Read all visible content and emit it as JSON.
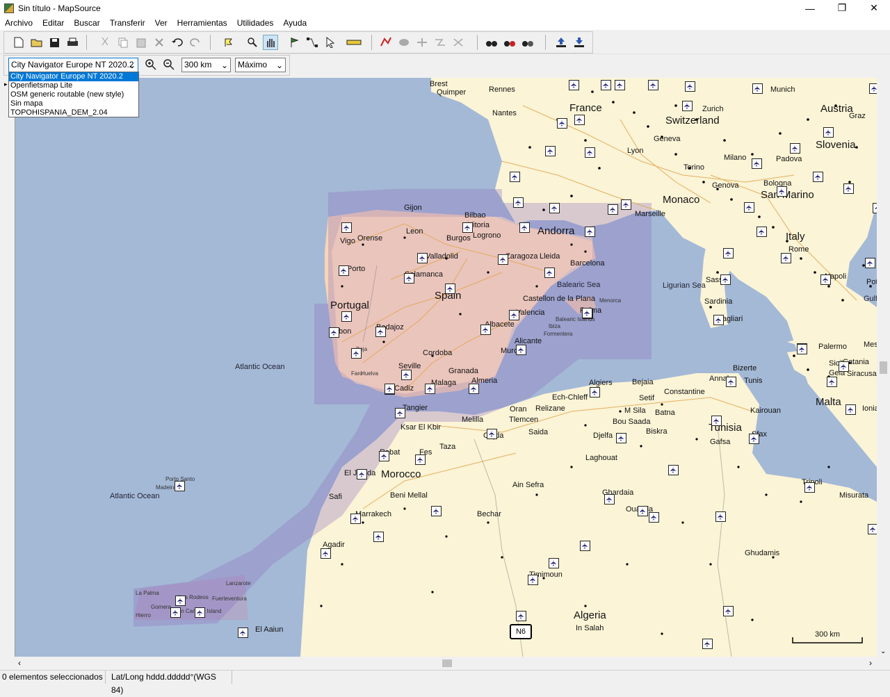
{
  "window": {
    "title": "Sin título - MapSource",
    "minimize": "—",
    "maximize": "❐",
    "close": "✕"
  },
  "menu": [
    "Archivo",
    "Editar",
    "Buscar",
    "Transferir",
    "Ver",
    "Herramientas",
    "Utilidades",
    "Ayuda"
  ],
  "toolbar2": {
    "map_product": "City Navigator Europe NT 2020.2",
    "map_options": [
      "City Navigator Europe NT 2020.2",
      "Openfietsmap Lite",
      "OSM generic routable (new style)",
      "Sin mapa",
      "TOPOHISPANIA_DEM_2.04"
    ],
    "zoom_scale": "300 km",
    "detail": "Máximo"
  },
  "map": {
    "countries": [
      {
        "t": "France"
      },
      {
        "t": "Switzerland"
      },
      {
        "t": "Austria"
      },
      {
        "t": "Slovenia"
      },
      {
        "t": "Monaco"
      },
      {
        "t": "San Marino"
      },
      {
        "t": "Italy"
      },
      {
        "t": "Andorra"
      },
      {
        "t": "Spain"
      },
      {
        "t": "Portugal"
      },
      {
        "t": "Morocco"
      },
      {
        "t": "Algeria"
      },
      {
        "t": "Tunisia"
      },
      {
        "t": "Malta"
      }
    ],
    "seas": [
      "Atlantic Ocean",
      "Atlantic Ocean",
      "Balearic Sea",
      "Ligurian Sea",
      "Gulf of"
    ],
    "cities": [
      "Brest",
      "Quimper",
      "Rennes",
      "Nantes",
      "Lyon",
      "Geneva",
      "Munich",
      "Zurich",
      "Graz",
      "Milano",
      "Torino",
      "Genova",
      "Bologna",
      "Padova",
      "Marseille",
      "Rome",
      "Napoli",
      "Potenz",
      "Sassari",
      "Sardinia",
      "Cagliari",
      "Palermo",
      "Messina",
      "Sicily",
      "Catania",
      "Gela",
      "Siracusa",
      "Ionian S",
      "Gijon",
      "Bilbao",
      "Vitoria",
      "Leon",
      "Burgos",
      "Logrono",
      "Vigo",
      "Orense",
      "Valladolid",
      "Zaragoza",
      "Lleida",
      "Barcelona",
      "Porto",
      "Salamanca",
      "Castellon de la Plana",
      "Palma",
      "Valencia",
      "Badajoz",
      "Lisbon",
      "Albacete",
      "Alicante",
      "Murcia",
      "Cordoba",
      "Seville",
      "Granada",
      "Malaga",
      "Almeria",
      "Cadiz",
      "Tangier",
      "Ksar El Kbir",
      "Melilla",
      "Oran",
      "Relizane",
      "Ech-Chleff",
      "Algiers",
      "Bejaia",
      "Setif",
      "Constantine",
      "Annaba",
      "Bizerte",
      "Tunis",
      "Kairouan",
      "Sfax",
      "Gafsa",
      "Batna",
      "Biskra",
      "M Sila",
      "Bou Saada",
      "Djelfa",
      "Tlemcen",
      "Oujda",
      "Saida",
      "Taza",
      "Fes",
      "Rabat",
      "El Jadida",
      "Safi",
      "Beni Mellal",
      "Marrakech",
      "Agadir",
      "Ain Sefra",
      "Bechar",
      "Laghouat",
      "Ghardaia",
      "Ouargla",
      "Timimoun",
      "Ghudamis",
      "Tripoli",
      "Misurata",
      "In Salah",
      "El Aaiun",
      "Madeira",
      "Porto Santo",
      "La Palma",
      "Gomera",
      "Hierro",
      "Las Rodeos",
      "Gran Canaria Island",
      "Lanzarote",
      "Fuerteventura",
      "Menorca",
      "Ibiza",
      "Formentera",
      "Balearic Islands",
      "Beja",
      "Faro",
      "Huelva"
    ],
    "shield": "N6",
    "scale": "300 km"
  },
  "status": {
    "selection": "0 elementos seleccionados",
    "coords": "Lat/Long hddd.ddddd°(WGS 84)"
  }
}
